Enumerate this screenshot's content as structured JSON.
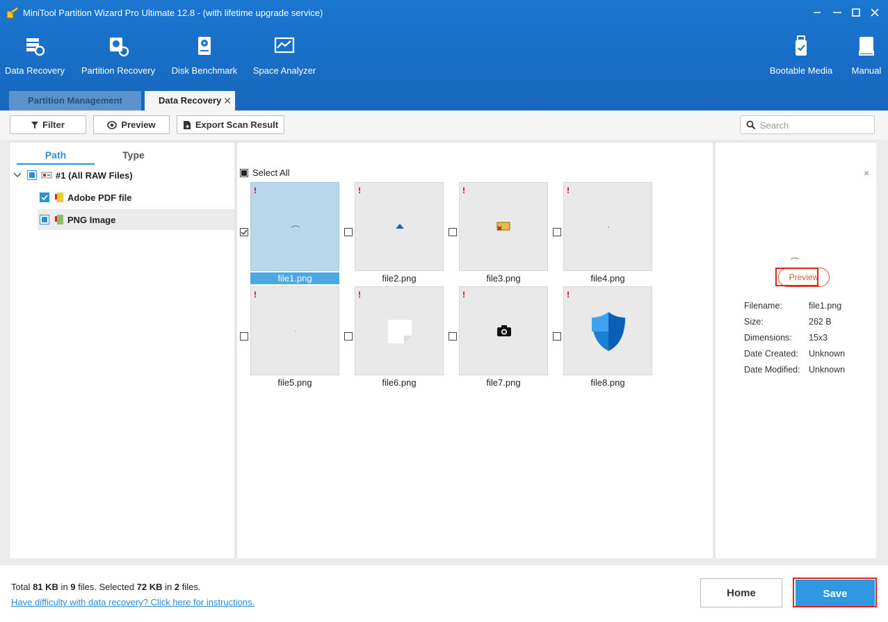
{
  "window": {
    "title": "MiniTool Partition Wizard Pro Ultimate 12.8 - (with lifetime upgrade service)"
  },
  "ribbon": {
    "items": [
      {
        "label": "Data Recovery",
        "icon": "data-recovery-icon"
      },
      {
        "label": "Partition Recovery",
        "icon": "partition-recovery-icon"
      },
      {
        "label": "Disk Benchmark",
        "icon": "disk-benchmark-icon"
      },
      {
        "label": "Space Analyzer",
        "icon": "space-analyzer-icon"
      },
      {
        "label": "Bootable Media",
        "icon": "bootable-media-icon"
      },
      {
        "label": "Manual",
        "icon": "manual-icon"
      }
    ]
  },
  "tabs": [
    {
      "label": "Partition Management",
      "active": false
    },
    {
      "label": "Data Recovery",
      "active": true,
      "close": "✕"
    }
  ],
  "toolbar": {
    "filter_label": "Filter",
    "preview_label": "Preview",
    "export_label": "Export Scan Result",
    "search_placeholder": "Search"
  },
  "left": {
    "subtabs": [
      "Path",
      "Type"
    ],
    "tree": [
      {
        "label": "#1 (All RAW Files)",
        "check": "partial"
      },
      {
        "label": "Adobe PDF file",
        "check": "full"
      },
      {
        "label": "PNG Image",
        "check": "partial"
      }
    ]
  },
  "grid": {
    "select_all_label": "Select All",
    "files": [
      {
        "name": "file1.png",
        "selected": true,
        "checked": true,
        "warn": "!"
      },
      {
        "name": "file2.png",
        "selected": false,
        "checked": false,
        "warn": "!"
      },
      {
        "name": "file3.png",
        "selected": false,
        "checked": false,
        "warn": "!"
      },
      {
        "name": "file4.png",
        "selected": false,
        "checked": false,
        "warn": "!"
      },
      {
        "name": "file5.png",
        "selected": false,
        "checked": false,
        "warn": "!"
      },
      {
        "name": "file6.png",
        "selected": false,
        "checked": false,
        "warn": "!"
      },
      {
        "name": "file7.png",
        "selected": false,
        "checked": false,
        "warn": "!"
      },
      {
        "name": "file8.png",
        "selected": false,
        "checked": false,
        "warn": "!"
      }
    ]
  },
  "preview": {
    "button_label": "Preview",
    "close": "×",
    "info": [
      {
        "key": "Filename:",
        "value": "file1.png"
      },
      {
        "key": "Size:",
        "value": "262 B"
      },
      {
        "key": "Dimensions:",
        "value": "15x3"
      },
      {
        "key": "Date Created:",
        "value": "Unknown"
      },
      {
        "key": "Date Modified:",
        "value": "Unknown"
      }
    ]
  },
  "footer": {
    "stats": {
      "p1": "Total ",
      "total_size": "81 KB",
      "p2": " in ",
      "total_files": "9",
      "p3": " files.  Selected ",
      "sel_size": "72 KB",
      "p4": " in ",
      "sel_files": "2",
      "p5": " files."
    },
    "help_link": "Have difficulty with data recovery? Click here for instructions.",
    "home_label": "Home",
    "save_label": "Save"
  },
  "colors": {
    "brand_blue": "#1a76cf",
    "accent": "#2d8fd6",
    "save": "#2f98e0",
    "warning": "#d40000",
    "highlight_box": "#e0211c"
  }
}
